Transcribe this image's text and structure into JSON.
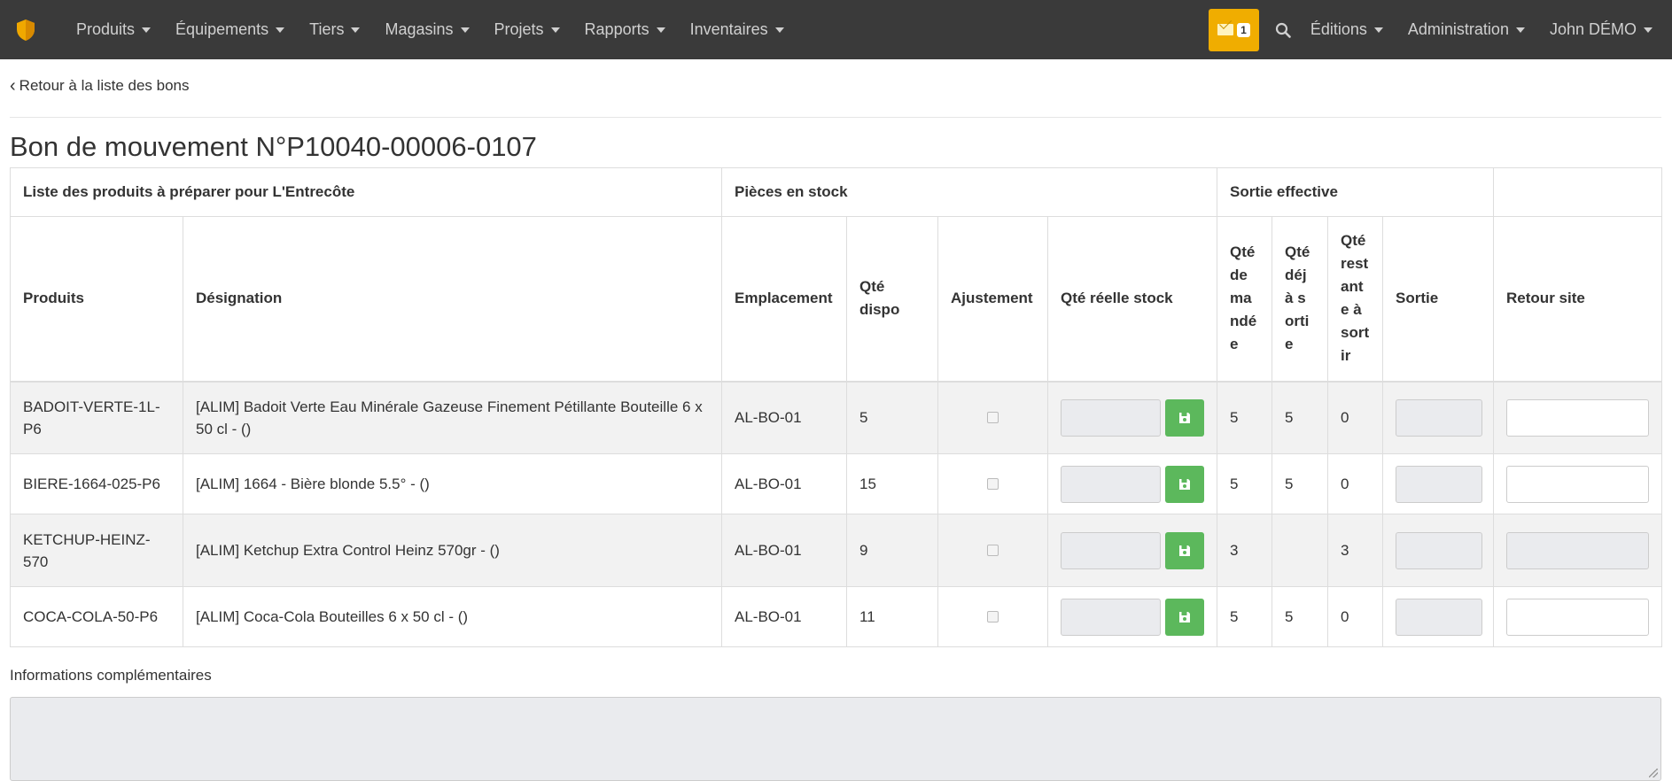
{
  "navbar": {
    "menus": [
      "Produits",
      "Équipements",
      "Tiers",
      "Magasins",
      "Projets",
      "Rapports",
      "Inventaires"
    ],
    "notification_count": "1",
    "editions": "Éditions",
    "administration": "Administration",
    "user": "John DÉMO"
  },
  "back_link": "Retour à la liste des bons",
  "page_title": "Bon de mouvement N°P10040-00006-0107",
  "table": {
    "groups": {
      "products": "Liste des produits à préparer pour L'Entrecôte",
      "stock": "Pièces en stock",
      "exit": "Sortie effective",
      "extra": ""
    },
    "headers": {
      "produits": "Produits",
      "designation": "Désignation",
      "emplacement": "Emplacement",
      "qte_dispo": "Qté dispo",
      "ajustement": "Ajustement",
      "qte_reelle": "Qté réelle stock",
      "qte_demandee": "Qté demandée",
      "qte_deja_sortie": "Qté déjà sortie",
      "qte_restante": "Qté restante à sortir",
      "sortie": "Sortie",
      "retour_site": "Retour site"
    },
    "rows": [
      {
        "produit": "BADOIT-VERTE-1L-P6",
        "designation": "[ALIM] Badoit Verte Eau Minérale Gazeuse Finement Pétillante Bouteille 6 x 50 cl - ()",
        "emplacement": "AL-BO-01",
        "dispo": "5",
        "demandee": "5",
        "deja": "5",
        "restante": "0",
        "retour_readonly": false
      },
      {
        "produit": "BIERE-1664-025-P6",
        "designation": "[ALIM] 1664 - Bière blonde 5.5° - ()",
        "emplacement": "AL-BO-01",
        "dispo": "15",
        "demandee": "5",
        "deja": "5",
        "restante": "0",
        "retour_readonly": false
      },
      {
        "produit": "KETCHUP-HEINZ-570",
        "designation": "[ALIM] Ketchup Extra Control Heinz 570gr - ()",
        "emplacement": "AL-BO-01",
        "dispo": "9",
        "demandee": "3",
        "deja": "",
        "restante": "3",
        "retour_readonly": true
      },
      {
        "produit": "COCA-COLA-50-P6",
        "designation": "[ALIM] Coca-Cola Bouteilles 6 x 50 cl - ()",
        "emplacement": "AL-BO-01",
        "dispo": "11",
        "demandee": "5",
        "deja": "5",
        "restante": "0",
        "retour_readonly": false
      }
    ]
  },
  "info_label": "Informations complémentaires",
  "info_value": ""
}
